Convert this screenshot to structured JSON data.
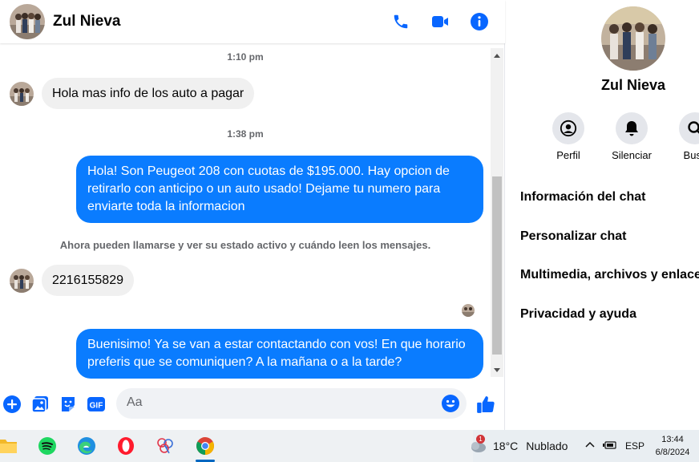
{
  "header": {
    "contact_name": "Zul Nieva",
    "actions": [
      "phone-icon",
      "video-camera-icon",
      "info-icon"
    ]
  },
  "conversation": {
    "time_1": "1:10 pm",
    "msg_in_1": "Hola mas info de los auto a pagar",
    "time_2": "1:38 pm",
    "msg_out_1_line1": "Hola! Son Peugeot 208 con cuotas de $195.000. Hay opcion de",
    "msg_out_1_line2": "retirarlo con anticipo o un auto usado! Dejame tu numero para",
    "msg_out_1_line3": "enviarte toda la informacion",
    "notice": "Ahora pueden llamarse y ver su estado activo y cuándo leen los mensajes.",
    "msg_in_2": "2216155829",
    "msg_out_2_line1": "Buenisimo! Ya se van a estar contactando con vos! En que horario",
    "msg_out_2_line2": "preferis que se comuniquen? A la mañana o a la tarde?"
  },
  "composer": {
    "placeholder": "Aa",
    "icons": [
      "plus-icon",
      "photo-icon",
      "sticker-icon",
      "gif-icon",
      "emoji-icon",
      "like-icon"
    ],
    "gif_label": "GIF"
  },
  "info_panel": {
    "name": "Zul Nieva",
    "actions": [
      {
        "label": "Perfil",
        "icon": "profile-icon"
      },
      {
        "label": "Silenciar",
        "icon": "bell-icon"
      },
      {
        "label": "Busc",
        "icon": "search-icon"
      }
    ],
    "menu": [
      "Información del chat",
      "Personalizar chat",
      "Multimedia, archivos y enlaces",
      "Privacidad y ayuda"
    ]
  },
  "taskbar": {
    "apps": [
      "file-explorer-icon",
      "spotify-icon",
      "edge-icon",
      "opera-icon",
      "app-icon",
      "chrome-icon"
    ],
    "weather_alert": "1",
    "temperature": "18°C",
    "weather": "Nublado",
    "language": "ESP",
    "time": "13:44",
    "date": "6/8/2024"
  },
  "colors": {
    "accent": "#0a7cff",
    "icon_blue": "#0866ff",
    "bubble_in": "#f0f0f0"
  }
}
